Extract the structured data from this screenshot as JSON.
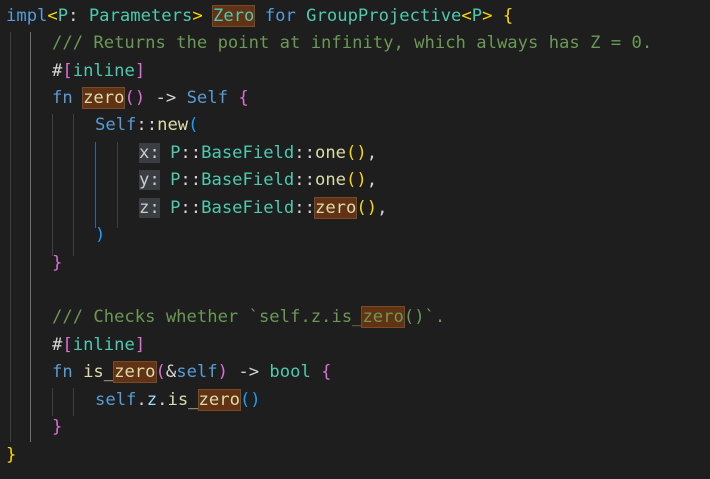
{
  "code": {
    "line1": {
      "impl": "impl",
      "lt": "<",
      "generic": "P",
      "colon": ": ",
      "bound": "Parameters",
      "gt": "> ",
      "trait": "Zero",
      "for": " for ",
      "target": "GroupProjective",
      "lt2": "<",
      "param": "P",
      "gt2": ">",
      "space": " ",
      "brace": "{"
    },
    "line2": {
      "comment": "/// Returns the point at infinity, which always has Z = 0."
    },
    "line3": {
      "hash": "#",
      "open": "[",
      "attr": "inline",
      "close": "]"
    },
    "line4": {
      "fn": "fn",
      "space": " ",
      "name": "zero",
      "parens": "()",
      "arrow": " -> ",
      "ret": "Self",
      "space2": " ",
      "brace": "{"
    },
    "line5": {
      "self": "Self",
      "sep": "::",
      "new": "new",
      "paren": "("
    },
    "line6": {
      "label": "x:",
      "space": " ",
      "p": "P",
      "sep1": "::",
      "field": "BaseField",
      "sep2": "::",
      "call": "one",
      "parens": "()",
      "comma": ","
    },
    "line7": {
      "label": "y:",
      "space": " ",
      "p": "P",
      "sep1": "::",
      "field": "BaseField",
      "sep2": "::",
      "call": "one",
      "parens": "()",
      "comma": ","
    },
    "line8": {
      "label": "z:",
      "space": " ",
      "p": "P",
      "sep1": "::",
      "field": "BaseField",
      "sep2": "::",
      "call": "zero",
      "parens": "()",
      "comma": ","
    },
    "line9": {
      "paren": ")"
    },
    "line10": {
      "brace": "}"
    },
    "line12": {
      "comment_a": "/// Checks whether `self.z.is_",
      "comment_hl": "zero",
      "comment_b": "()`."
    },
    "line13": {
      "hash": "#",
      "open": "[",
      "attr": "inline",
      "close": "]"
    },
    "line14": {
      "fn": "fn",
      "space": " ",
      "name_a": "is_",
      "name_hl": "zero",
      "open": "(",
      "amp": "&",
      "self": "self",
      "close": ")",
      "arrow": " -> ",
      "ret": "bool",
      "space2": " ",
      "brace": "{"
    },
    "line15": {
      "self": "self",
      "dot1": ".",
      "z": "z",
      "dot2": ".",
      "call_a": "is_",
      "call_hl": "zero",
      "parens": "()"
    },
    "line16": {
      "brace": "}"
    },
    "line17": {
      "brace": "}"
    }
  },
  "theme": {
    "background": "#1e1e1e",
    "keyword": "#569cd6",
    "control_keyword": "#c586c0",
    "type": "#4ec9b0",
    "function": "#dcdcaa",
    "comment": "#6a9955",
    "word_highlight": "#613214"
  }
}
